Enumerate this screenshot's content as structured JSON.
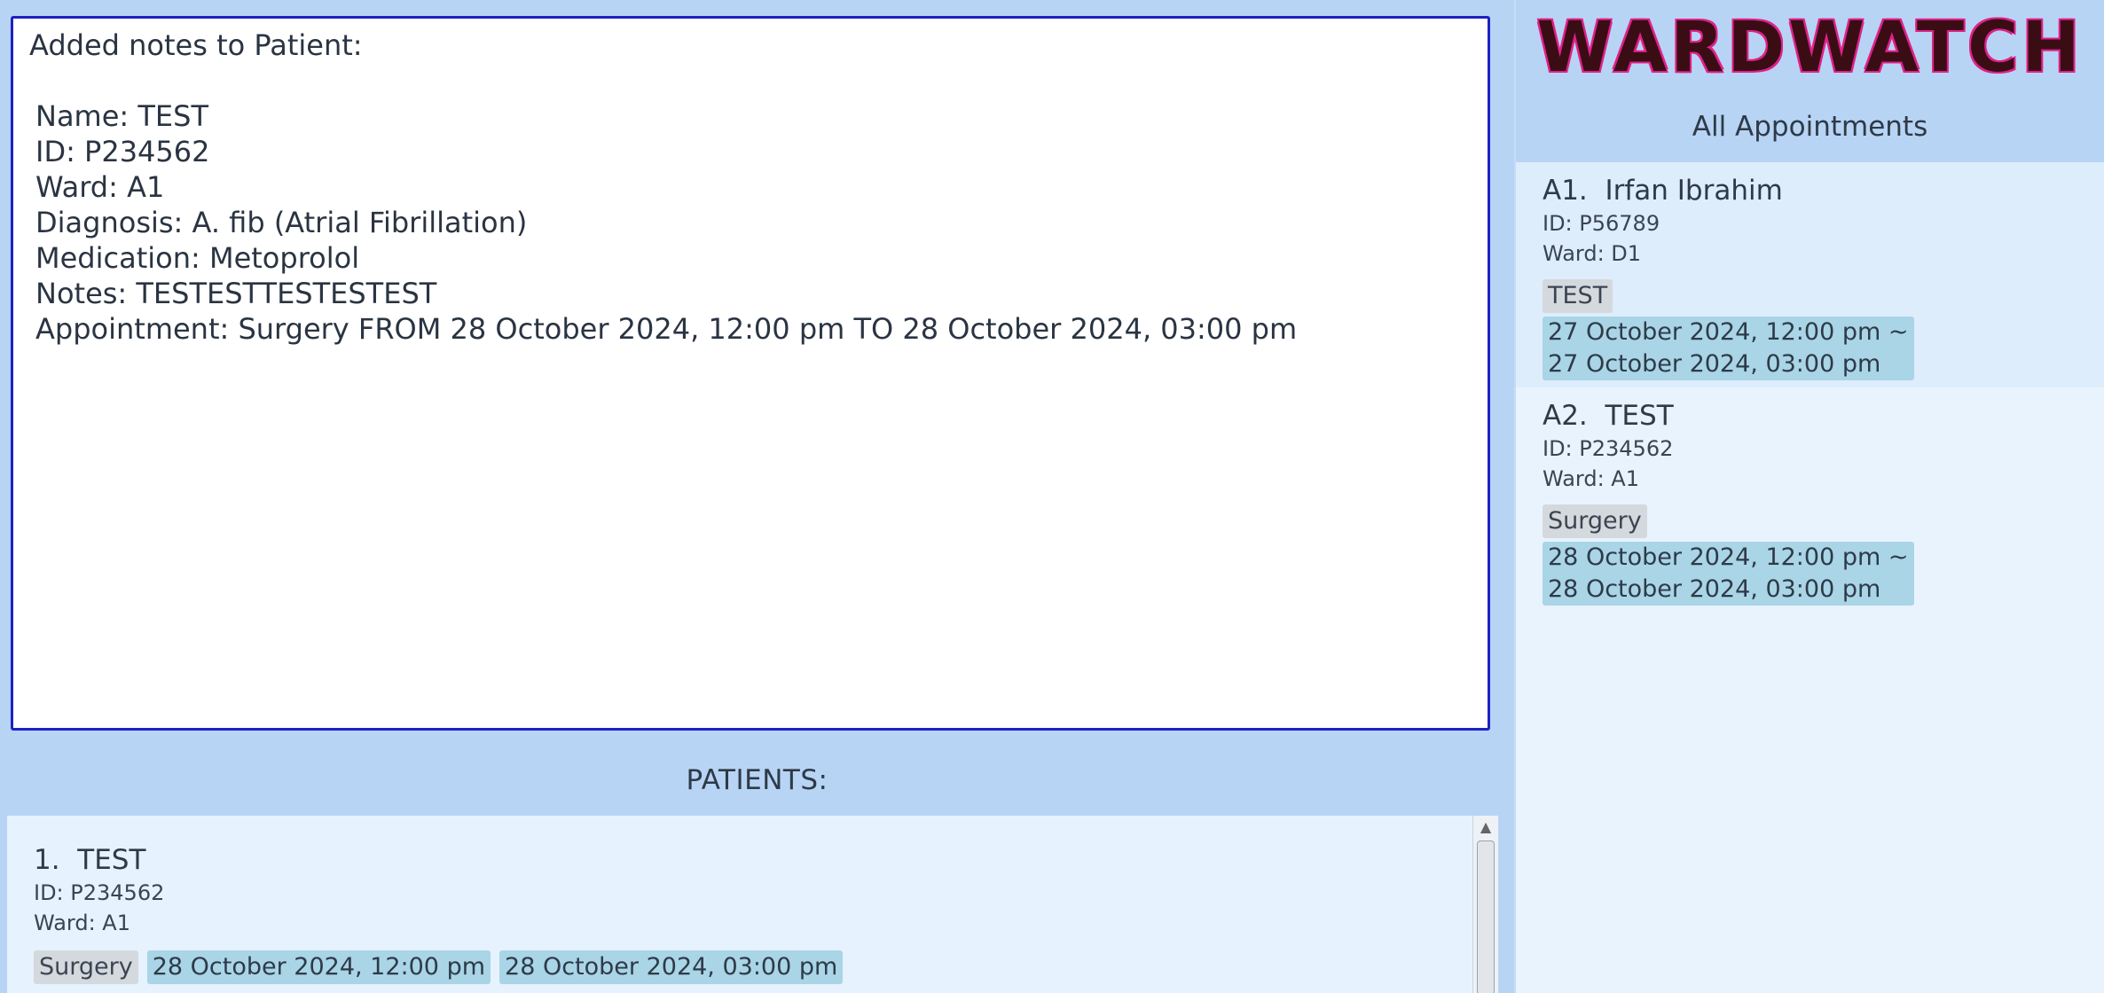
{
  "result": {
    "heading": "Added notes to Patient:",
    "lines": [
      "Name: TEST",
      "ID: P234562",
      "Ward: A1",
      "Diagnosis: A. fib (Atrial Fibrillation)",
      "Medication: Metoprolol",
      "Notes: TESTESTTESTESTEST",
      "Appointment: Surgery FROM 28 October 2024, 12:00 pm TO 28 October 2024, 03:00 pm"
    ]
  },
  "patients": {
    "header": "PATIENTS:",
    "items": [
      {
        "title": "1.  TEST",
        "id": "ID: P234562",
        "ward": "Ward: A1",
        "appointment": "Surgery",
        "start": "28 October 2024, 12:00 pm",
        "end": "28 October 2024, 03:00 pm"
      }
    ]
  },
  "app": {
    "logo": "WARDWATCH",
    "appointments_title": "All Appointments"
  },
  "appointments": [
    {
      "title": "A1.  Irfan Ibrahim",
      "id": "ID: P56789",
      "ward": "Ward: D1",
      "description": "TEST",
      "start": "27 October 2024, 12:00 pm ~",
      "end": "27 October 2024, 03:00 pm"
    },
    {
      "title": "A2.  TEST",
      "id": "ID: P234562",
      "ward": "Ward: A1",
      "description": "Surgery",
      "start": "28 October 2024, 12:00 pm ~",
      "end": "28 October 2024, 03:00 pm"
    }
  ],
  "colors": {
    "background": "#b8d4f4",
    "card_background": "#e6f2fd",
    "result_border": "#1d21c4",
    "logo_fill": "#3a0d14",
    "logo_outline": "#e0208a",
    "date_tag": "#a9d5e6",
    "description_tag": "#d4d9de"
  }
}
